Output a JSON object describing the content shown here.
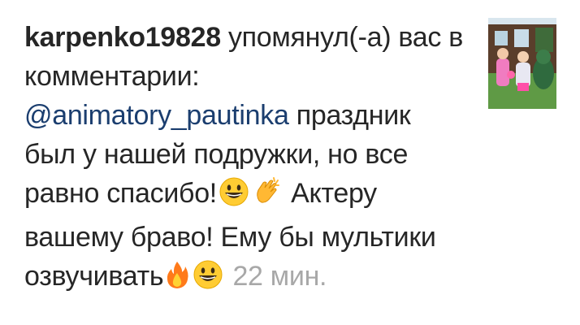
{
  "notification": {
    "username": "karpenko19828",
    "action": "упомянул(-а) вас в комментарии:",
    "mention": "@animatory_pautinka",
    "text_part1": "праздник был у нашей подружки, но все равно спасибо!",
    "text_part2": "Актеру вашему браво! Ему бы мультики озвучивать",
    "time": "22 мин.",
    "emojis": [
      "grinning-face",
      "clapping-hands",
      "fire",
      "grinning-face"
    ]
  },
  "thumbnail": {
    "icon": "post-photo-thumbnail"
  }
}
